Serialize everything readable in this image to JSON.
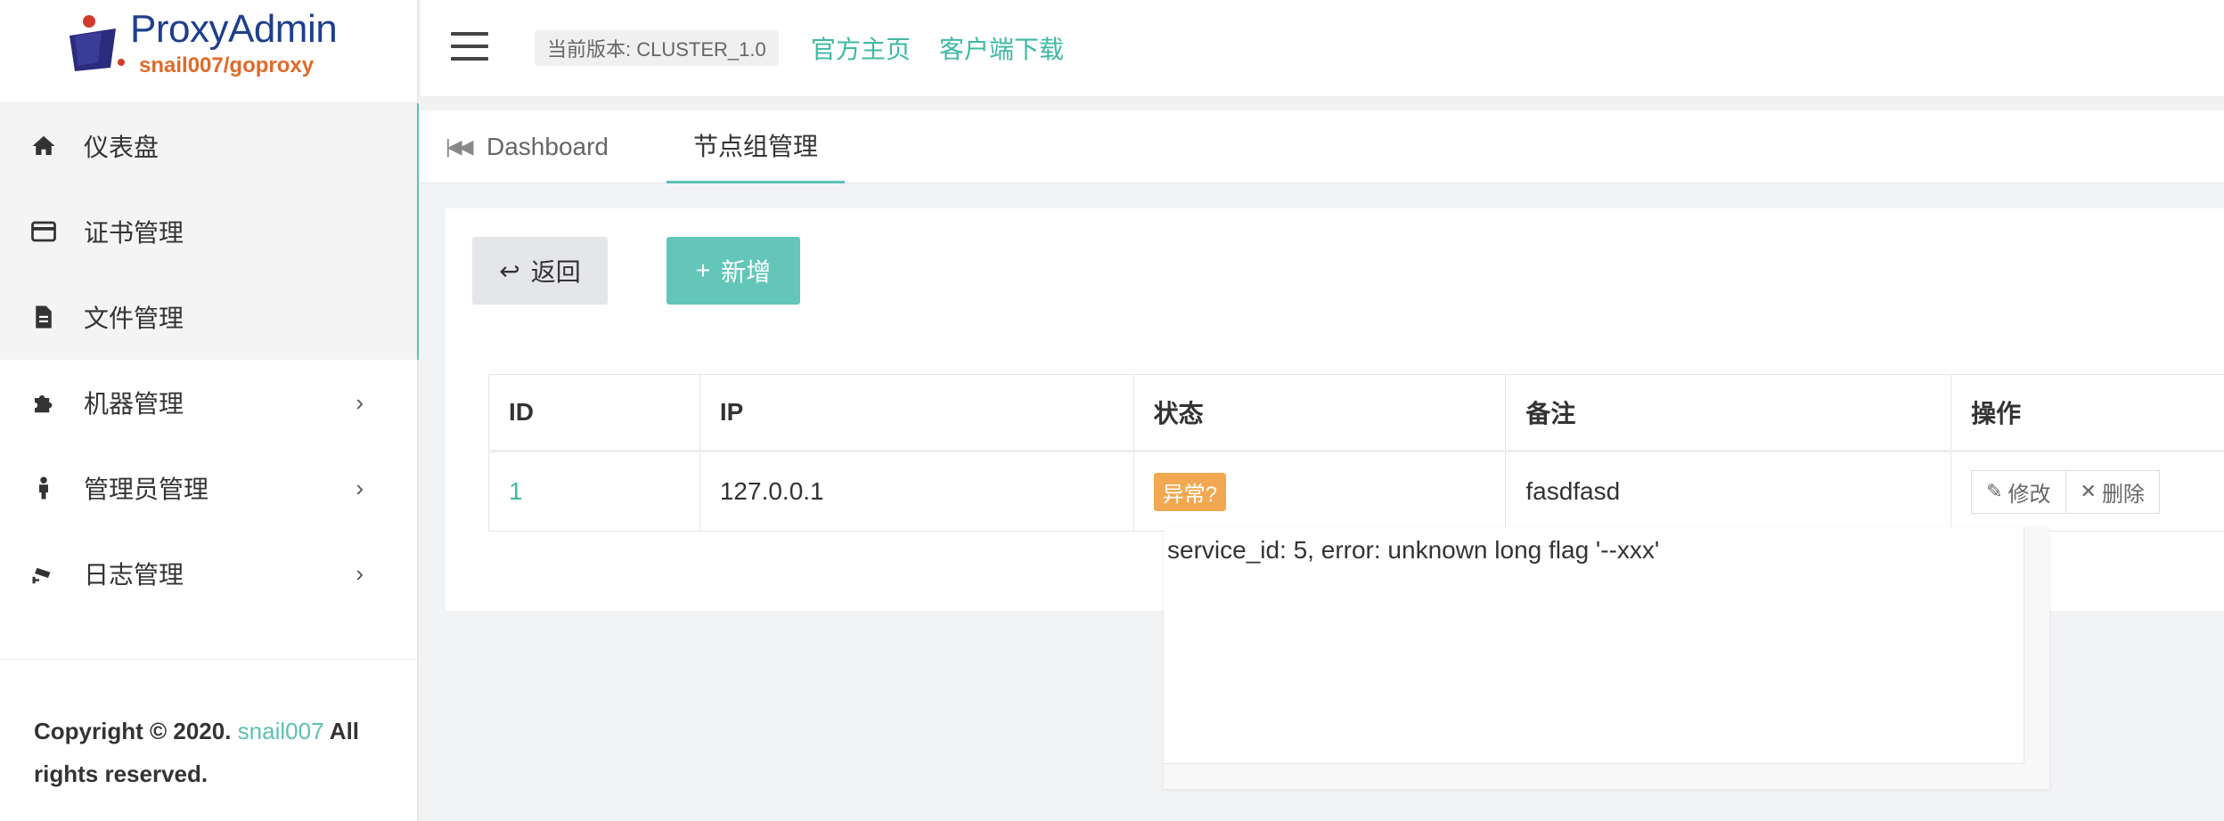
{
  "brand": {
    "name": "ProxyAdmin",
    "subtitle": "snail007/goproxy"
  },
  "header": {
    "version": "当前版本: CLUSTER_1.0",
    "links": [
      "官方主页",
      "客户端下载"
    ]
  },
  "sidebar": {
    "items": [
      {
        "label": "仪表盘",
        "icon": "home-icon"
      },
      {
        "label": "证书管理",
        "icon": "credit-card-icon"
      },
      {
        "label": "文件管理",
        "icon": "file-icon"
      },
      {
        "label": "机器管理",
        "icon": "puzzle-icon",
        "arrow": "›"
      },
      {
        "label": "管理员管理",
        "icon": "user-icon",
        "arrow": "›"
      },
      {
        "label": "日志管理",
        "icon": "cctv-icon",
        "arrow": "›"
      }
    ],
    "footer": {
      "prefix": "Copyright © 2020.",
      "link": "snail007",
      "suffix": "All rights reserved."
    }
  },
  "tabs": {
    "items": [
      "Dashboard",
      "节点组管理"
    ],
    "active": "节点组管理"
  },
  "toolbar": {
    "back": "返回",
    "add": "新增"
  },
  "table": {
    "columns": [
      "ID",
      "IP",
      "状态",
      "备注",
      "操作"
    ],
    "rows": [
      {
        "id": "1",
        "ip": "127.0.0.1",
        "status": "异常?",
        "note": "fasdfasd",
        "edit": "修改",
        "delete": "删除"
      }
    ]
  },
  "popover": {
    "text": "service_id: 5, error: unknown long flag '--xxx'"
  },
  "colors": {
    "accent": "#5bc2b3",
    "warning": "#f2a851",
    "brand_blue": "#1f3f8c",
    "brand_orange": "#e06a28"
  }
}
